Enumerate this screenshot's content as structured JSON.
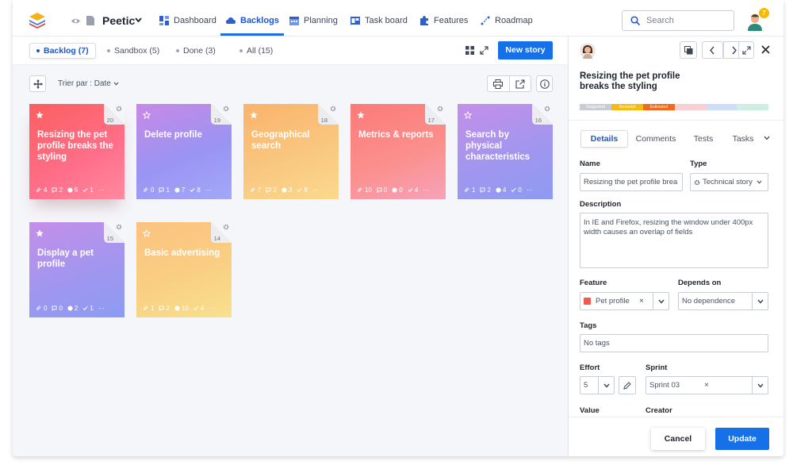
{
  "app": {
    "project_name": "Peetic",
    "notifications": "7"
  },
  "nav": {
    "items": [
      {
        "label": "Dashboard"
      },
      {
        "label": "Backlogs"
      },
      {
        "label": "Planning"
      },
      {
        "label": "Task board"
      },
      {
        "label": "Features"
      },
      {
        "label": "Roadmap"
      }
    ],
    "active": "Backlogs",
    "search_placeholder": "Search"
  },
  "backlog_tabs": [
    {
      "label": "Backlog (7)"
    },
    {
      "label": "Sandbox (5)"
    },
    {
      "label": "Done (3)"
    },
    {
      "label": "All (15)"
    }
  ],
  "toolbar": {
    "new_story": "New story",
    "sort_label": "Trier par :",
    "sort_value": "Date"
  },
  "cards": [
    {
      "title": "Resizing the pet profile breaks the styling",
      "number": "20",
      "starred": true,
      "stats": [
        "4",
        "2",
        "5",
        "1"
      ],
      "color": "red"
    },
    {
      "title": "Delete profile",
      "number": "19",
      "starred": false,
      "stats": [
        "0",
        "1",
        "7",
        "8"
      ],
      "color": "purple"
    },
    {
      "title": "Geographical search",
      "number": "18",
      "starred": true,
      "stats": [
        "7",
        "2",
        "3",
        "8"
      ],
      "color": "orange"
    },
    {
      "title": "Metrics & reports",
      "number": "17",
      "starred": true,
      "stats": [
        "10",
        "0",
        "0",
        "4"
      ],
      "color": "pink"
    },
    {
      "title": "Search by physical characteristics",
      "number": "16",
      "starred": false,
      "stats": [
        "1",
        "2",
        "4",
        "0"
      ],
      "color": "violet"
    },
    {
      "title": "Display a pet profile",
      "number": "15",
      "starred": true,
      "stats": [
        "0",
        "0",
        "2",
        "1"
      ],
      "color": "violet"
    },
    {
      "title": "Basic advertising",
      "number": "14",
      "starred": false,
      "stats": [
        "1",
        "2",
        "10",
        "4"
      ],
      "color": "yellow"
    }
  ],
  "panel": {
    "title": "Resizing the pet profile breaks the styling",
    "status": [
      {
        "label": "Suggested",
        "color": "#c9ccd4"
      },
      {
        "label": "Accepted",
        "color": "#f5bb12"
      },
      {
        "label": "Estimated",
        "color": "#f06a1e"
      },
      {
        "label": "",
        "color": "#f8cfd2"
      },
      {
        "label": "",
        "color": "#ccdff6"
      },
      {
        "label": "",
        "color": "#cdeee0"
      }
    ],
    "tabs": [
      {
        "label": "Details"
      },
      {
        "label": "Comments"
      },
      {
        "label": "Tests"
      },
      {
        "label": "Tasks"
      }
    ],
    "fields": {
      "name_label": "Name",
      "name_value": "Resizing the pet profile brea",
      "type_label": "Type",
      "type_value": "Technical story",
      "description_label": "Description",
      "description_value": "In IE and Firefox, resizing the window under 400px width causes an overlap of fields",
      "feature_label": "Feature",
      "feature_value": "Pet profile",
      "depends_label": "Depends on",
      "depends_value": "No dependence",
      "tags_label": "Tags",
      "tags_value": "No tags",
      "effort_label": "Effort",
      "effort_value": "5",
      "sprint_label": "Sprint",
      "sprint_value": "Sprint 03",
      "value_label": "Value",
      "creator_label": "Creator"
    },
    "cancel": "Cancel",
    "update": "Update"
  },
  "colors": {
    "accent": "#1670e8",
    "nav_active": "#1f56c7"
  }
}
